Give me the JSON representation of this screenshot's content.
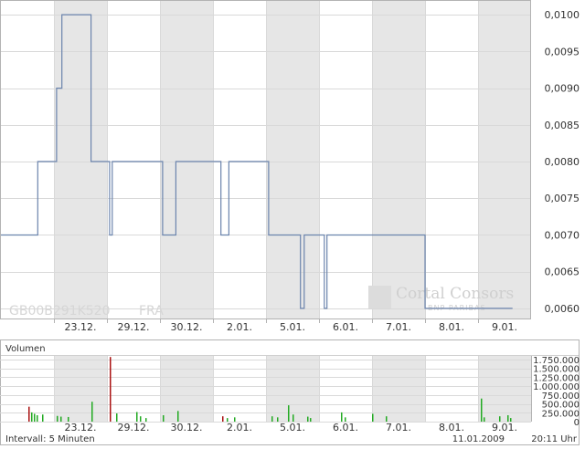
{
  "watermark": {
    "isin": "GB00B291K520",
    "exchange": "FRA",
    "brand": "Cortal Consors",
    "brand_sub": "BNP PARIBAS"
  },
  "colors": {
    "price_line": "#6b84ad",
    "shade": "#e6e6e6",
    "grid": "#d9d9d9",
    "border": "#b3b3b3",
    "volume_up": "#22aa22",
    "volume_down": "#aa1111"
  },
  "volume_panel": {
    "title": "Volumen",
    "interval": "Intervall: 5 Minuten",
    "date": "11.01.2009",
    "time": "20:11 Uhr"
  },
  "chart_data": [
    {
      "type": "line",
      "name": "price",
      "x_tick_labels": [
        "23.12.",
        "29.12.",
        "30.12.",
        "2.01.",
        "5.01.",
        "6.01.",
        "7.01.",
        "8.01.",
        "9.01."
      ],
      "y_tick_values": [
        0.006,
        0.0065,
        0.007,
        0.0075,
        0.008,
        0.0085,
        0.009,
        0.0095,
        0.01
      ],
      "y_tick_labels": [
        "0,0060",
        "0,0065",
        "0,0070",
        "0,0075",
        "0,0080",
        "0,0085",
        "0,0090",
        "0,0095",
        "0,0100"
      ],
      "ylim": [
        0.00585,
        0.0102
      ],
      "shaded_days": [
        "23.12.",
        "30.12.",
        "5.01.",
        "7.01.",
        "9.01."
      ],
      "grid": true,
      "series": [
        {
          "x": [
            0,
            0.7,
            0.7,
            1.05,
            1.05,
            1.15,
            1.15,
            1.7,
            1.7,
            2.05,
            2.05,
            2.1,
            2.1,
            3.05,
            3.05,
            3.3,
            3.3,
            4.15,
            4.15,
            4.3,
            4.3,
            5.05,
            5.05,
            5.65,
            5.65,
            5.72,
            5.72,
            6.1,
            6.1,
            6.15,
            6.15,
            6.4,
            6.4,
            8.0,
            8.0,
            9.65
          ],
          "y": [
            0.007,
            0.007,
            0.008,
            0.008,
            0.009,
            0.009,
            0.01,
            0.01,
            0.008,
            0.008,
            0.007,
            0.007,
            0.008,
            0.008,
            0.007,
            0.007,
            0.008,
            0.008,
            0.007,
            0.007,
            0.008,
            0.008,
            0.007,
            0.007,
            0.006,
            0.006,
            0.007,
            0.007,
            0.006,
            0.006,
            0.007,
            0.007,
            0.007,
            0.007,
            0.006,
            0.006
          ]
        }
      ]
    },
    {
      "type": "bar",
      "name": "volume",
      "title": "Volumen",
      "x_tick_labels": [
        "23.12.",
        "29.12.",
        "30.12.",
        "2.01.",
        "5.01.",
        "6.01.",
        "7.01.",
        "8.01.",
        "9.01."
      ],
      "y_tick_values": [
        0,
        250000,
        500000,
        750000,
        1000000,
        1250000,
        1500000,
        1750000
      ],
      "y_tick_labels": [
        "0",
        "250.000",
        "500.000",
        "750.000",
        "1.000.000",
        "1.250.000",
        "1.500.000",
        "1.750.000"
      ],
      "ylim": [
        0,
        1850000
      ],
      "bars": [
        {
          "x": 0.52,
          "v": 420000,
          "d": "down"
        },
        {
          "x": 0.57,
          "v": 260000,
          "d": "up"
        },
        {
          "x": 0.62,
          "v": 220000,
          "d": "up"
        },
        {
          "x": 0.68,
          "v": 180000,
          "d": "up"
        },
        {
          "x": 0.78,
          "v": 200000,
          "d": "up"
        },
        {
          "x": 1.05,
          "v": 160000,
          "d": "up"
        },
        {
          "x": 1.12,
          "v": 140000,
          "d": "up"
        },
        {
          "x": 1.25,
          "v": 130000,
          "d": "up"
        },
        {
          "x": 1.7,
          "v": 560000,
          "d": "up"
        },
        {
          "x": 2.05,
          "v": 1820000,
          "d": "down"
        },
        {
          "x": 2.18,
          "v": 230000,
          "d": "up"
        },
        {
          "x": 2.55,
          "v": 270000,
          "d": "up"
        },
        {
          "x": 2.62,
          "v": 150000,
          "d": "up"
        },
        {
          "x": 2.72,
          "v": 100000,
          "d": "up"
        },
        {
          "x": 3.05,
          "v": 180000,
          "d": "up"
        },
        {
          "x": 3.32,
          "v": 300000,
          "d": "up"
        },
        {
          "x": 4.18,
          "v": 150000,
          "d": "down"
        },
        {
          "x": 4.25,
          "v": 100000,
          "d": "up"
        },
        {
          "x": 4.4,
          "v": 120000,
          "d": "up"
        },
        {
          "x": 5.1,
          "v": 150000,
          "d": "up"
        },
        {
          "x": 5.2,
          "v": 120000,
          "d": "up"
        },
        {
          "x": 5.42,
          "v": 460000,
          "d": "up"
        },
        {
          "x": 5.5,
          "v": 200000,
          "d": "up"
        },
        {
          "x": 5.78,
          "v": 140000,
          "d": "up"
        },
        {
          "x": 5.82,
          "v": 100000,
          "d": "up"
        },
        {
          "x": 6.42,
          "v": 260000,
          "d": "up"
        },
        {
          "x": 6.48,
          "v": 120000,
          "d": "up"
        },
        {
          "x": 7.0,
          "v": 220000,
          "d": "up"
        },
        {
          "x": 7.25,
          "v": 150000,
          "d": "up"
        },
        {
          "x": 9.05,
          "v": 650000,
          "d": "up"
        },
        {
          "x": 9.1,
          "v": 120000,
          "d": "up"
        },
        {
          "x": 9.4,
          "v": 150000,
          "d": "up"
        },
        {
          "x": 9.55,
          "v": 180000,
          "d": "up"
        },
        {
          "x": 9.6,
          "v": 100000,
          "d": "up"
        }
      ]
    }
  ]
}
